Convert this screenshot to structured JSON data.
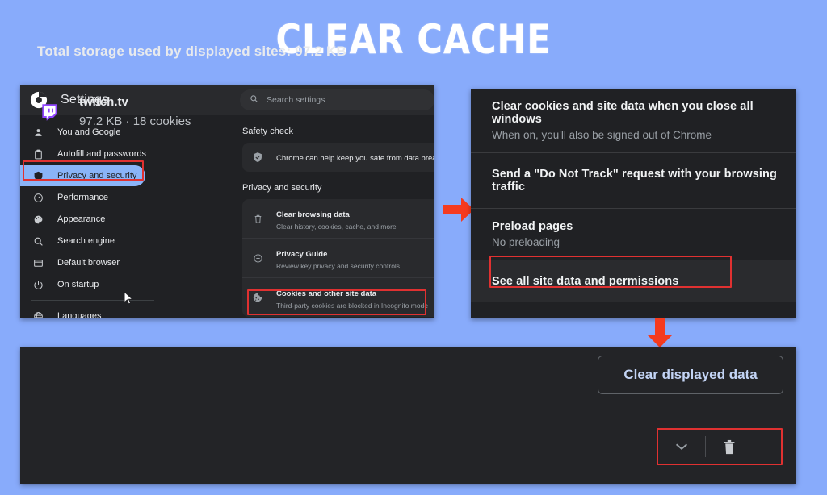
{
  "page": {
    "title": "CLEAR CACHE",
    "background_color": "#88abfb",
    "accent_red": "#e03131",
    "accent_blue": "#8ab4f8"
  },
  "settings_window": {
    "brand_icon": "chrome-logo-icon",
    "title": "Settings",
    "search": {
      "icon": "search-icon",
      "placeholder": "Search settings",
      "value": ""
    },
    "sidebar": {
      "items": [
        {
          "label": "You and Google",
          "icon": "person-icon",
          "active": false
        },
        {
          "label": "Autofill and passwords",
          "icon": "clipboard-icon",
          "active": false
        },
        {
          "label": "Privacy and security",
          "icon": "shield-icon",
          "active": true
        },
        {
          "label": "Performance",
          "icon": "speedometer-icon",
          "active": false
        },
        {
          "label": "Appearance",
          "icon": "palette-icon",
          "active": false
        },
        {
          "label": "Search engine",
          "icon": "magnifier-icon",
          "active": false
        },
        {
          "label": "Default browser",
          "icon": "browser-window-icon",
          "active": false
        },
        {
          "label": "On startup",
          "icon": "power-icon",
          "active": false
        },
        {
          "label": "Languages",
          "icon": "globe-icon",
          "active": false
        }
      ]
    },
    "main": {
      "safety_check": {
        "heading": "Safety check",
        "row": {
          "icon": "shield-check-icon",
          "text": "Chrome can help keep you safe from data breaches, b"
        }
      },
      "privacy_and_security": {
        "heading": "Privacy and security",
        "rows": [
          {
            "icon": "trash-icon",
            "title": "Clear browsing data",
            "subtitle": "Clear history, cookies, cache, and more",
            "highlighted": false
          },
          {
            "icon": "privacy-guide-icon",
            "title": "Privacy Guide",
            "subtitle": "Review key privacy and security controls",
            "highlighted": false
          },
          {
            "icon": "cookie-icon",
            "title": "Cookies and other site data",
            "subtitle": "Third-party cookies are blocked in Incognito mode",
            "highlighted": true
          }
        ]
      }
    }
  },
  "cookies_panel": {
    "rows": [
      {
        "title": "Clear cookies and site data when you close all windows",
        "subtitle": "When on, you'll also be signed out of Chrome",
        "highlighted": false
      },
      {
        "title": "Send a \"Do Not Track\" request with your browsing traffic",
        "subtitle": "",
        "highlighted": false
      },
      {
        "title": "Preload pages",
        "subtitle": "No preloading",
        "highlighted": false
      },
      {
        "title": "See all site data and permissions",
        "subtitle": "",
        "highlighted": true
      }
    ]
  },
  "storage_panel": {
    "total_label": "Total storage used by displayed sites: 97.2 KB",
    "clear_button": "Clear displayed data",
    "site": {
      "icon": "twitch-icon",
      "name": "twitch.tv",
      "meta": "97.2 KB · 18 cookies",
      "expand_icon": "chevron-down-icon",
      "delete_icon": "trash-icon"
    }
  },
  "arrows": [
    {
      "name": "arrow-right-settings-to-cookies",
      "direction": "right"
    },
    {
      "name": "arrow-down-cookies-to-storage",
      "direction": "down"
    }
  ]
}
